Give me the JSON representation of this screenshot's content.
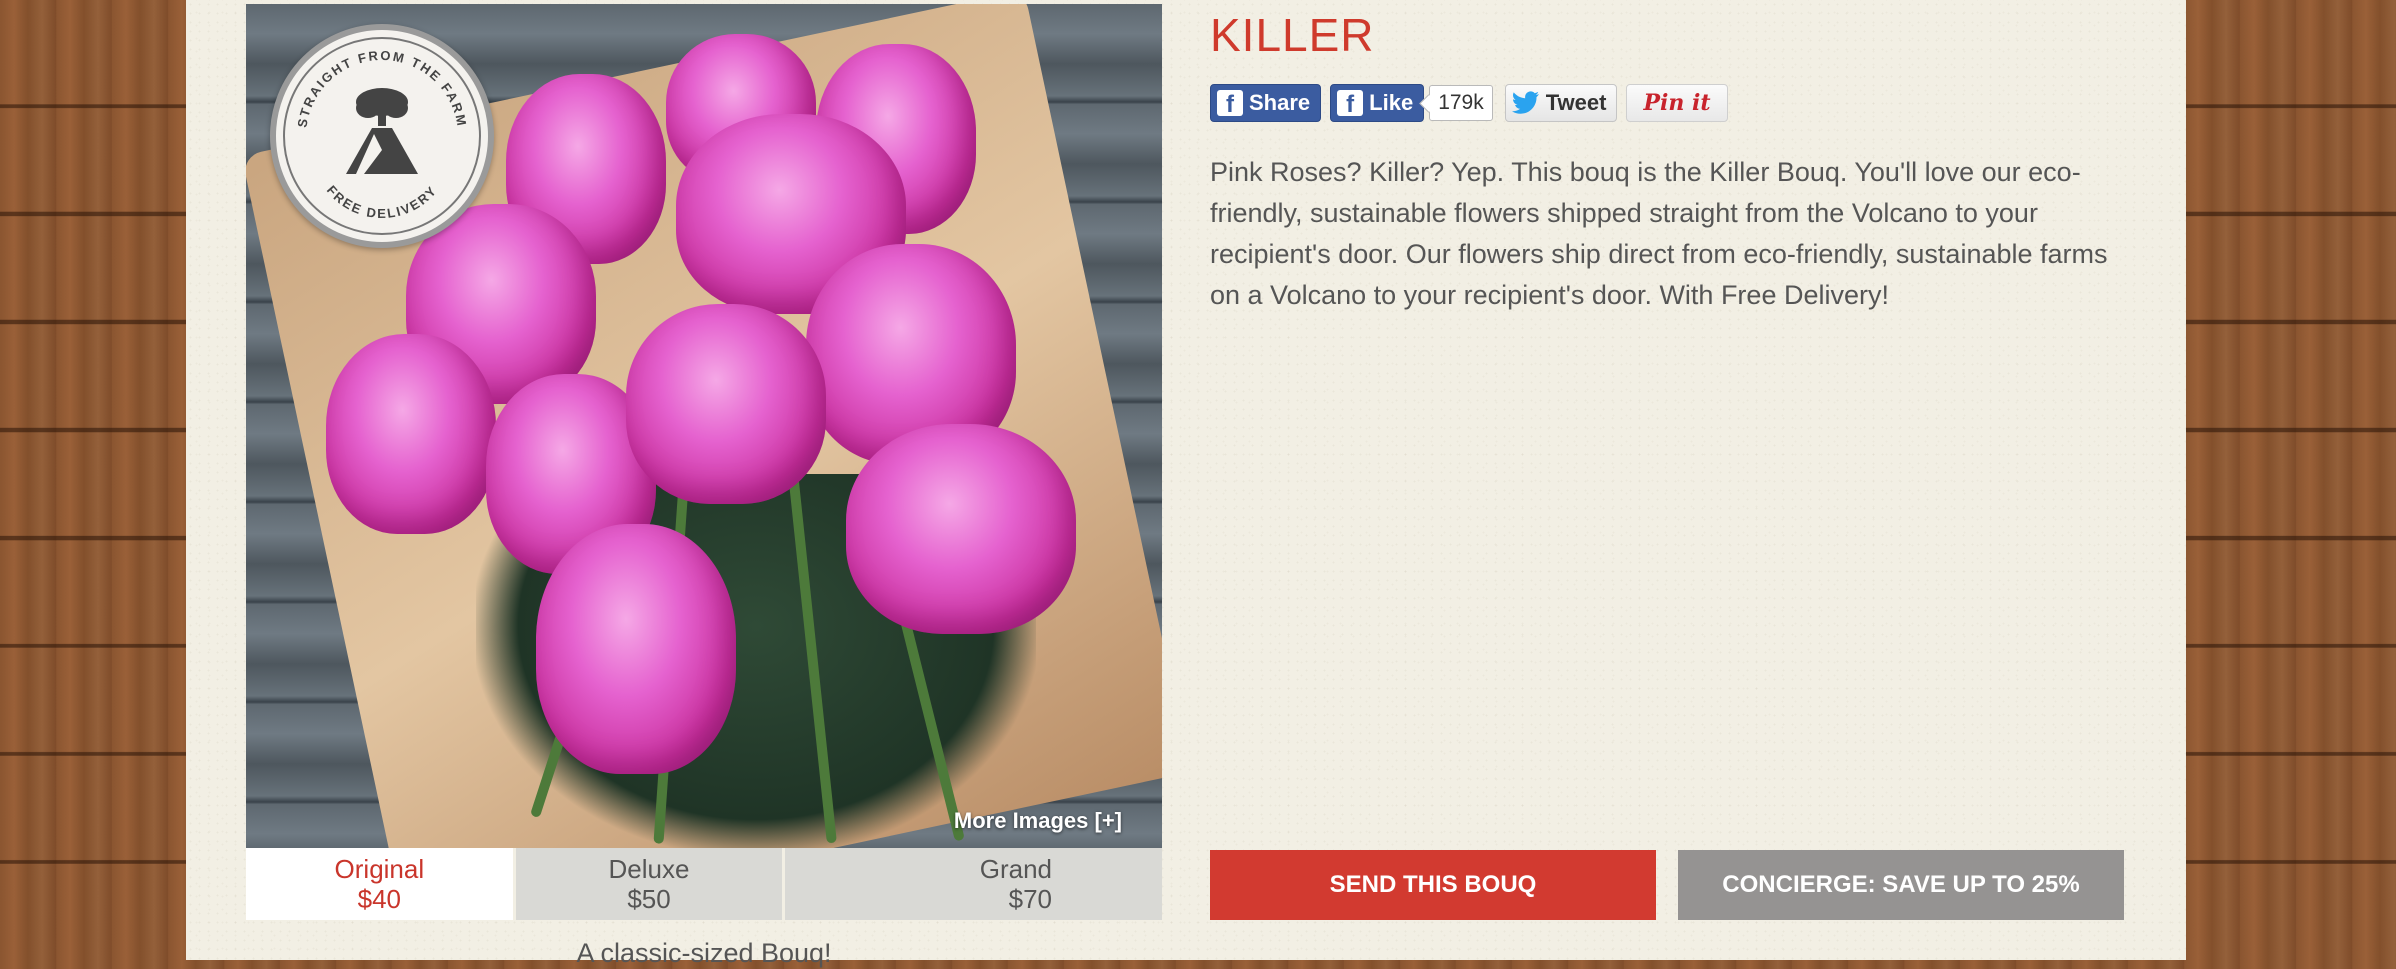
{
  "product": {
    "title": "KILLER",
    "description": "Pink Roses? Killer? Yep. This bouq is the Killer Bouq. You'll love our eco-friendly, sustainable flowers shipped straight from the Volcano to your recipient's door. Our flowers ship direct from eco-friendly, sustainable farms on a Volcano to your recipient's door. With Free Delivery!",
    "more_images_label": "More Images [+]",
    "seal_text_top": "STRAIGHT FROM THE FARM",
    "seal_text_bottom": "FREE DELIVERY"
  },
  "social": {
    "share_label": "Share",
    "like_label": "Like",
    "like_count": "179k",
    "tweet_label": "Tweet",
    "pin_label": "Pin it"
  },
  "sizes": [
    {
      "name": "Original",
      "price": "$40",
      "selected": true
    },
    {
      "name": "Deluxe",
      "price": "$50",
      "selected": false
    },
    {
      "name": "Grand",
      "price": "$70",
      "selected": false
    }
  ],
  "size_caption": "A classic-sized Bouq!",
  "actions": {
    "send_label": "SEND THIS BOUQ",
    "concierge_label": "CONCIERGE: SAVE UP TO 25%"
  },
  "colors": {
    "accent_red": "#d23a30",
    "title_red": "#cf3a2c",
    "concierge_gray": "#959392",
    "facebook_blue": "#3b5ca0"
  },
  "icons": [
    "facebook-icon",
    "twitter-icon",
    "volcano-icon"
  ]
}
